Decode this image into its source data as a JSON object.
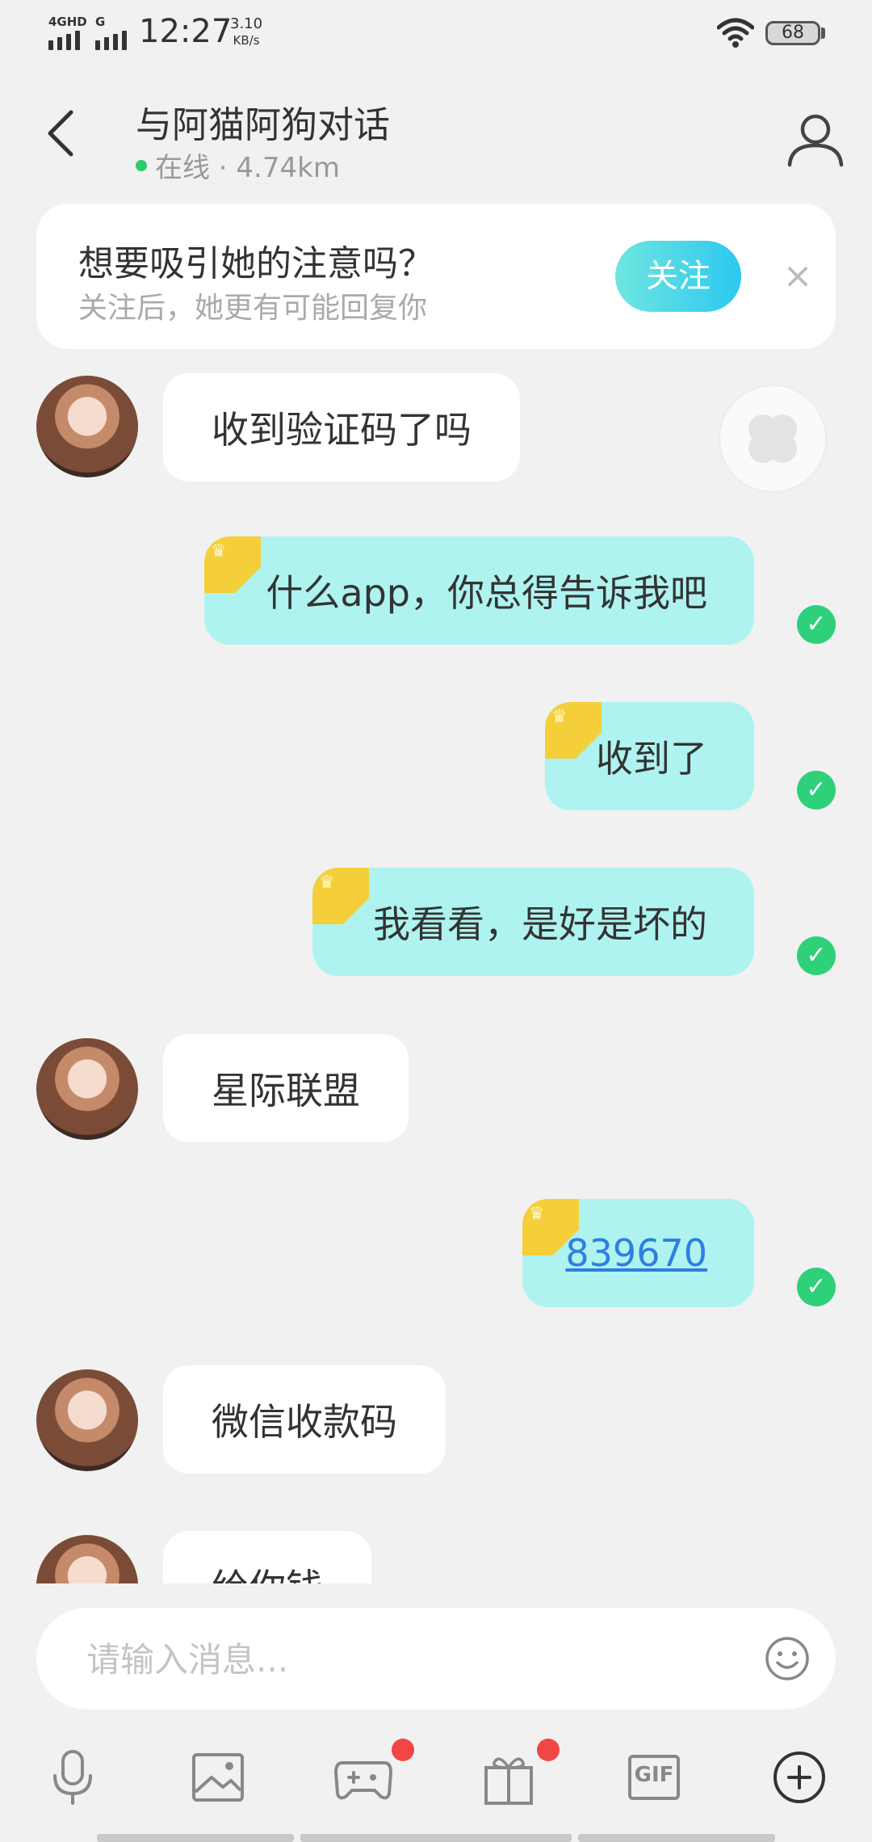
{
  "status_bar": {
    "network_1": "4GHD",
    "network_2": "G",
    "time": "12:27",
    "speed_value": "3.10",
    "speed_unit": "KB/s",
    "battery": "68"
  },
  "header": {
    "title": "与阿猫阿狗对话",
    "online_status": "在线 · 4.74km"
  },
  "follow_card": {
    "title": "想要吸引她的注意吗？",
    "subtitle": "关注后，她更有可能回复你",
    "button_label": "关注",
    "close_label": "×"
  },
  "messages": [
    {
      "side": "in",
      "text": "收到验证码了吗"
    },
    {
      "side": "out",
      "text": "什么app，你总得告诉我吧",
      "read": true
    },
    {
      "side": "out",
      "text": "收到了",
      "read": true
    },
    {
      "side": "out",
      "text": "我看看，是好是坏的",
      "read": true
    },
    {
      "side": "in",
      "text": "星际联盟"
    },
    {
      "side": "out",
      "text": "839670",
      "read": true,
      "link": true
    },
    {
      "side": "in",
      "text": "微信收款码"
    },
    {
      "side": "in",
      "text": "给你钱"
    }
  ],
  "input": {
    "placeholder": "请输入消息..."
  },
  "toolbar": {
    "items": [
      "microphone-icon",
      "image-icon",
      "game-icon",
      "gift-icon",
      "gif-icon",
      "plus-icon"
    ],
    "gif_label": "GIF"
  },
  "colors": {
    "accent": "#2cc8f0",
    "bubble_out": "#aef3ef",
    "read_check": "#2ed07a",
    "badge": "#f04646",
    "link": "#2f7ee2"
  }
}
